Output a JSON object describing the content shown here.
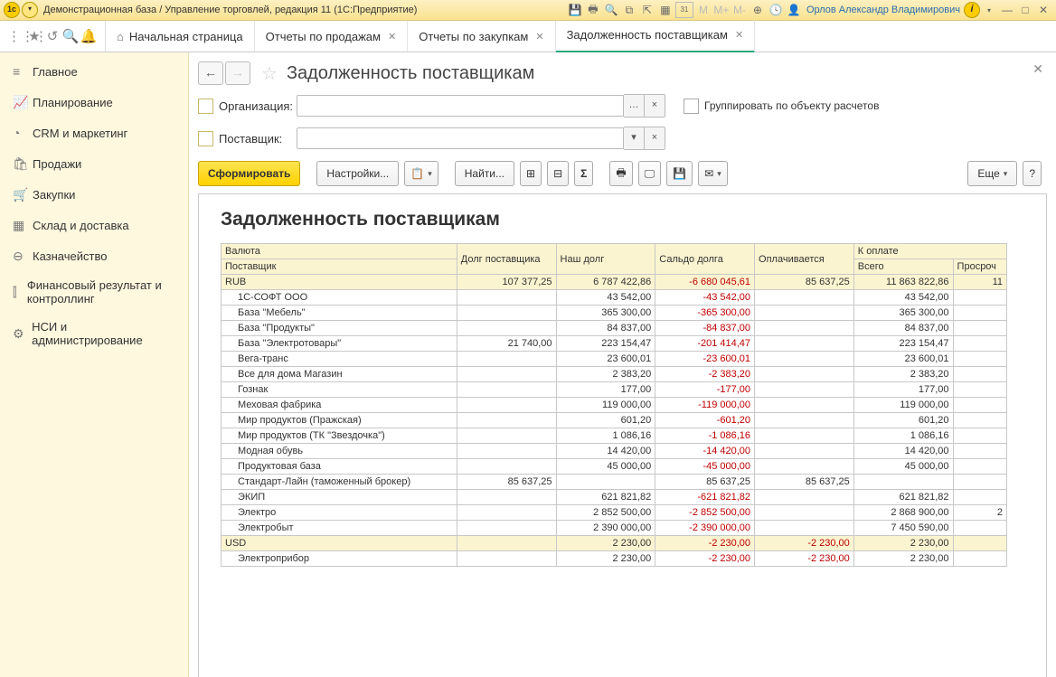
{
  "titlebar": {
    "title": "Демонстрационная база / Управление торговлей, редакция 11 (1С:Предприятие)",
    "user": "Орлов Александр Владимирович",
    "m_labels": [
      "M",
      "M+",
      "M-"
    ],
    "cal": "31"
  },
  "tabs": {
    "home": "Начальная страница",
    "t1": "Отчеты по продажам",
    "t2": "Отчеты по закупкам",
    "t3": "Задолженность поставщикам"
  },
  "sidebar": {
    "items": [
      {
        "icon": "≡",
        "label": "Главное"
      },
      {
        "icon": "📈",
        "label": "Планирование"
      },
      {
        "icon": "◔",
        "label": "CRM и маркетинг"
      },
      {
        "icon": "🛍",
        "label": "Продажи"
      },
      {
        "icon": "🛒",
        "label": "Закупки"
      },
      {
        "icon": "▦",
        "label": "Склад и доставка"
      },
      {
        "icon": "⊖",
        "label": "Казначейство"
      },
      {
        "icon": "⫿",
        "label": "Финансовый результат и контроллинг"
      },
      {
        "icon": "⚙",
        "label": "НСИ и администрирование"
      }
    ]
  },
  "page": {
    "title": "Задолженность поставщикам",
    "filters": {
      "org_label": "Организация:",
      "supplier_label": "Поставщик:",
      "group_label": "Группировать по объекту расчетов"
    },
    "buttons": {
      "form": "Сформировать",
      "settings": "Настройки...",
      "find": "Найти...",
      "more": "Еще"
    }
  },
  "report": {
    "title": "Задолженность поставщикам",
    "headers": {
      "currency": "Валюта",
      "supplier": "Поставщик",
      "debt_supplier": "Долг поставщика",
      "our_debt": "Наш долг",
      "saldo": "Сальдо долга",
      "paying": "Оплачивается",
      "to_pay": "К оплате",
      "total": "Всего",
      "overdue": "Просроч"
    },
    "groups": [
      {
        "name": "RUB",
        "debt_supplier": "107 377,25",
        "our_debt": "6 787 422,86",
        "saldo": "-6 680 045,61",
        "paying": "85 637,25",
        "total": "11 863 822,86",
        "overdue": "11",
        "rows": [
          {
            "name": "1С-СОФТ ООО",
            "debt_supplier": "",
            "our_debt": "43 542,00",
            "saldo": "-43 542,00",
            "paying": "",
            "total": "43 542,00"
          },
          {
            "name": "База \"Мебель\"",
            "debt_supplier": "",
            "our_debt": "365 300,00",
            "saldo": "-365 300,00",
            "paying": "",
            "total": "365 300,00"
          },
          {
            "name": "База \"Продукты\"",
            "debt_supplier": "",
            "our_debt": "84 837,00",
            "saldo": "-84 837,00",
            "paying": "",
            "total": "84 837,00"
          },
          {
            "name": "База \"Электротовары\"",
            "debt_supplier": "21 740,00",
            "our_debt": "223 154,47",
            "saldo": "-201 414,47",
            "paying": "",
            "total": "223 154,47"
          },
          {
            "name": "Вега-транс",
            "debt_supplier": "",
            "our_debt": "23 600,01",
            "saldo": "-23 600,01",
            "paying": "",
            "total": "23 600,01"
          },
          {
            "name": "Все для дома Магазин",
            "debt_supplier": "",
            "our_debt": "2 383,20",
            "saldo": "-2 383,20",
            "paying": "",
            "total": "2 383,20"
          },
          {
            "name": "Гознак",
            "debt_supplier": "",
            "our_debt": "177,00",
            "saldo": "-177,00",
            "paying": "",
            "total": "177,00"
          },
          {
            "name": "Меховая фабрика",
            "debt_supplier": "",
            "our_debt": "119 000,00",
            "saldo": "-119 000,00",
            "paying": "",
            "total": "119 000,00"
          },
          {
            "name": "Мир продуктов (Пражская)",
            "debt_supplier": "",
            "our_debt": "601,20",
            "saldo": "-601,20",
            "paying": "",
            "total": "601,20"
          },
          {
            "name": "Мир продуктов (ТК \"Звездочка\")",
            "debt_supplier": "",
            "our_debt": "1 086,16",
            "saldo": "-1 086,16",
            "paying": "",
            "total": "1 086,16"
          },
          {
            "name": "Модная обувь",
            "debt_supplier": "",
            "our_debt": "14 420,00",
            "saldo": "-14 420,00",
            "paying": "",
            "total": "14 420,00"
          },
          {
            "name": "Продуктовая база",
            "debt_supplier": "",
            "our_debt": "45 000,00",
            "saldo": "-45 000,00",
            "paying": "",
            "total": "45 000,00"
          },
          {
            "name": "Стандарт-Лайн (таможенный брокер)",
            "debt_supplier": "85 637,25",
            "our_debt": "",
            "saldo": "85 637,25",
            "paying": "85 637,25",
            "total": ""
          },
          {
            "name": "ЭКИП",
            "debt_supplier": "",
            "our_debt": "621 821,82",
            "saldo": "-621 821,82",
            "paying": "",
            "total": "621 821,82"
          },
          {
            "name": "Электро",
            "debt_supplier": "",
            "our_debt": "2 852 500,00",
            "saldo": "-2 852 500,00",
            "paying": "",
            "total": "2 868 900,00",
            "overdue": "2"
          },
          {
            "name": "Электробыт",
            "debt_supplier": "",
            "our_debt": "2 390 000,00",
            "saldo": "-2 390 000,00",
            "paying": "",
            "total": "7 450 590,00",
            "overdue": ""
          }
        ]
      },
      {
        "name": "USD",
        "debt_supplier": "",
        "our_debt": "2 230,00",
        "saldo": "-2 230,00",
        "paying": "-2 230,00",
        "total": "2 230,00",
        "rows": [
          {
            "name": "Электроприбор",
            "debt_supplier": "",
            "our_debt": "2 230,00",
            "saldo": "-2 230,00",
            "paying": "-2 230,00",
            "total": "2 230,00"
          }
        ]
      }
    ]
  }
}
